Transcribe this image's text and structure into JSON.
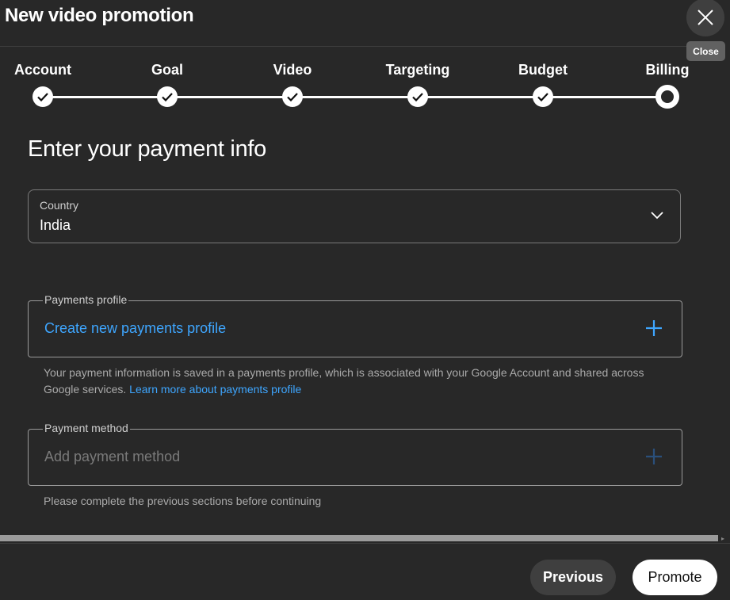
{
  "dialog": {
    "title": "New video promotion",
    "close_tooltip": "Close",
    "close_icon": "close-icon"
  },
  "steps": [
    {
      "label": "Account",
      "status": "completed"
    },
    {
      "label": "Goal",
      "status": "completed"
    },
    {
      "label": "Video",
      "status": "completed"
    },
    {
      "label": "Targeting",
      "status": "completed"
    },
    {
      "label": "Budget",
      "status": "completed"
    },
    {
      "label": "Billing",
      "status": "current"
    }
  ],
  "page": {
    "heading": "Enter your payment info"
  },
  "country": {
    "label": "Country",
    "value": "India"
  },
  "payments_profile": {
    "legend": "Payments profile",
    "action": "Create new payments profile",
    "helper_text": "Your payment information is saved in a payments profile, which is associated with your Google Account and shared across Google services.",
    "helper_link": "Learn more about payments profile"
  },
  "payment_method": {
    "legend": "Payment method",
    "action": "Add payment method",
    "helper_text": "Please complete the previous sections before continuing"
  },
  "footer": {
    "previous_label": "Previous",
    "promote_label": "Promote"
  },
  "colors": {
    "background": "#282828",
    "accent": "#3ea6ff",
    "disabled_text": "#7a7a7a",
    "disabled_plus": "#2a4f7a"
  }
}
